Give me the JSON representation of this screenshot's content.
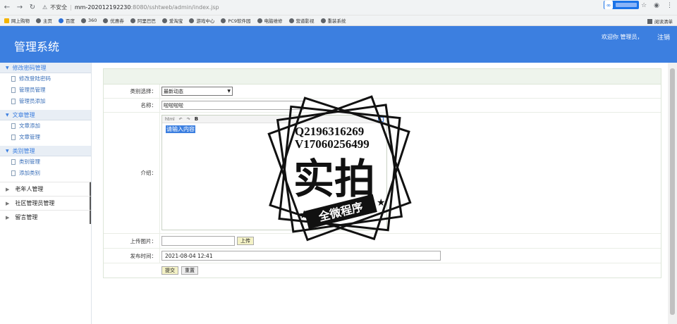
{
  "browser": {
    "security_label": "不安全",
    "url_host": "mm-202012192230",
    "url_rest": ":8080/sshtweb/admin/index.jsp",
    "bookmarks": [
      "网上购物",
      "主页",
      "百度",
      "360",
      "优惠券",
      "阿里巴巴",
      "爱淘宝",
      "游戏中心",
      "PC9软件园",
      "电脑维修",
      "营道影视",
      "重装系统"
    ],
    "reading_list": "阅读清单"
  },
  "header": {
    "title": "管理系统",
    "welcome": "欢迎你 管理员，",
    "logout": "注销",
    "color": "#3c7fe0"
  },
  "sidebar": {
    "groups": [
      {
        "label": "修改密码管理",
        "items": [
          "修改登陆密码",
          "管理员管理",
          "管理员添加"
        ]
      },
      {
        "label": "文章管理",
        "items": [
          "文章添加",
          "文章管理"
        ]
      },
      {
        "label": "类别管理",
        "items": [
          "类别管理",
          "添加类别"
        ]
      }
    ],
    "collapsed": [
      "老年人管理",
      "社区管理员管理",
      "留言管理"
    ]
  },
  "form": {
    "category_label": "类别选择：",
    "category_value": "最新动态",
    "name_label": "名称：",
    "name_value": "啦啦啦啦",
    "intro_label": "介绍：",
    "editor_toolbar": [
      "html",
      "B"
    ],
    "editor_placeholder": "请输入内容",
    "upload_label": "上传图片：",
    "upload_button": "上传",
    "time_label": "发布时间：",
    "time_value": "2021-08-04 12:41",
    "submit_button": "提交",
    "reset_button": "重置"
  },
  "watermark": {
    "line1": "Q2196316269",
    "line2": "V17060256499",
    "main": "实拍",
    "banner": "全微程序"
  }
}
